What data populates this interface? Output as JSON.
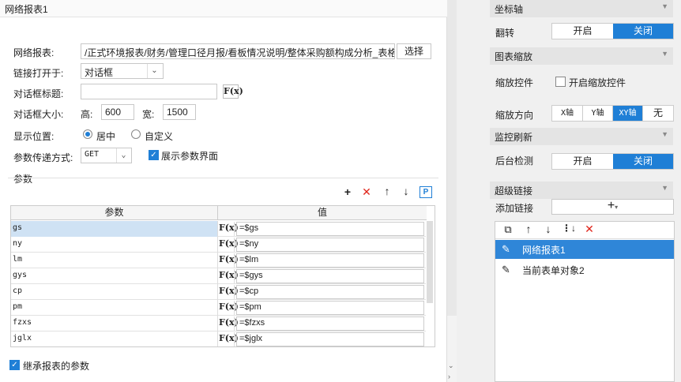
{
  "dialog": {
    "title": "网络报表1",
    "report_label": "网络报表:",
    "report_path": "/正式环境报表/财务/管理口径月报/看板情况说明/整体采购额构成分析_表格",
    "select_button": "选择",
    "open_in_label": "链接打开于:",
    "open_in_value": "对话框",
    "dialog_title_label": "对话框标题:",
    "dialog_title_value": "",
    "dialog_size_label": "对话框大小:",
    "height_label": "高:",
    "height_value": "600",
    "width_label": "宽:",
    "width_value": "1500",
    "position_label": "显示位置:",
    "position_center": "居中",
    "position_custom": "自定义",
    "param_method_label": "参数传递方式:",
    "param_method_value": "GET",
    "show_params_label": "展示参数界面",
    "params_group_label": "参数",
    "param_col_header": "参数",
    "value_col_header": "值",
    "fx_label": "F(x)",
    "params": [
      {
        "name": "gs",
        "value": "=$gs"
      },
      {
        "name": "ny",
        "value": "=$ny"
      },
      {
        "name": "lm",
        "value": "=$lm"
      },
      {
        "name": "gys",
        "value": "=$gys"
      },
      {
        "name": "cp",
        "value": "=$cp"
      },
      {
        "name": "pm",
        "value": "=$pm"
      },
      {
        "name": "fzxs",
        "value": "=$fzxs"
      },
      {
        "name": "jglx",
        "value": "=$jglx"
      }
    ],
    "inherit_params_label": "继承报表的参数"
  },
  "panel": {
    "axis_section": "坐标轴",
    "flip_label": "翻转",
    "flip_on": "开启",
    "flip_off": "关闭",
    "zoom_section": "图表缩放",
    "zoom_control_label": "缩放控件",
    "zoom_control_checkbox": "开启缩放控件",
    "zoom_dir_label": "缩放方向",
    "zoom_dirs": [
      "X轴",
      "Y轴",
      "XY轴",
      "无"
    ],
    "monitor_section": "监控刷新",
    "bg_check_label": "后台检测",
    "bg_on": "开启",
    "bg_off": "关闭",
    "hyperlink_section": "超级链接",
    "add_link_label": "添加链接",
    "links": [
      "网络报表1",
      "当前表单对象2"
    ]
  }
}
